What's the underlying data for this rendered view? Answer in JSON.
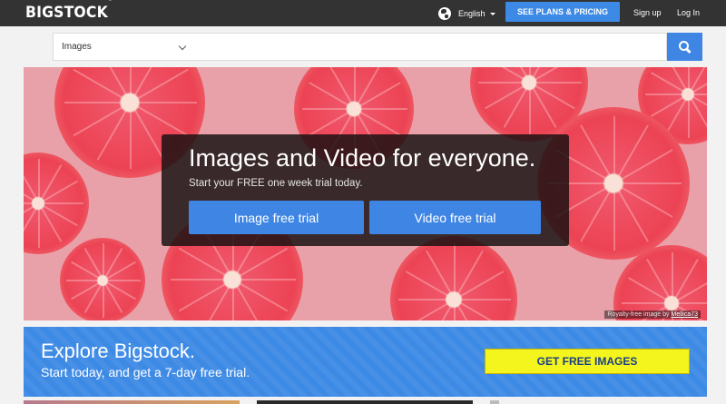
{
  "header": {
    "logo": "BIGSTOCK",
    "logo_tm": "™",
    "language": "English",
    "plans_button": "SEE PLANS & PRICING",
    "signup": "Sign up",
    "login": "Log In"
  },
  "search": {
    "type_selected": "Images",
    "placeholder": ""
  },
  "hero": {
    "title": "Images and Video for everyone.",
    "subtitle": "Start your FREE one week trial today.",
    "image_trial_button": "Image free trial",
    "video_trial_button": "Video free trial",
    "credit_prefix": "Royalty-free image by",
    "credit_author": "Mellica73"
  },
  "promo": {
    "title": "Explore Bigstock.",
    "subtitle": "Start today, and get a 7-day free trial.",
    "button": "GET FREE IMAGES"
  },
  "colors": {
    "topbar": "#333333",
    "accent_blue": "#3f86e4",
    "hero_pink": "#e8a1a8",
    "promo_yellow": "#f3f51d"
  }
}
